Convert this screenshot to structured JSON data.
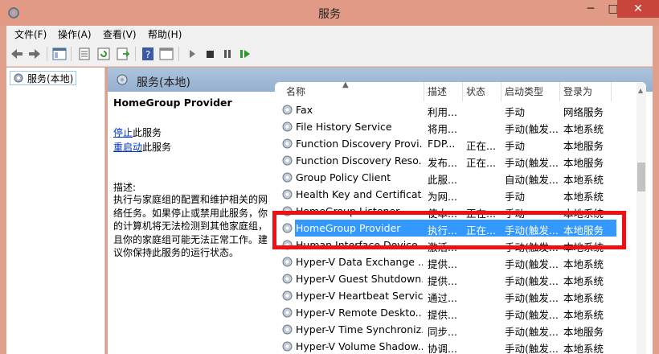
{
  "window": {
    "title": "服务"
  },
  "menu": [
    "文件(F)",
    "操作(A)",
    "查看(V)",
    "帮助(H)"
  ],
  "tree": {
    "item": "服务(本地)"
  },
  "main": {
    "header": "服务(本地)"
  },
  "detail": {
    "service_name": "HomeGroup Provider",
    "action_stop_link": "停止",
    "action_stop_suffix": "此服务",
    "action_restart_link": "重启动",
    "action_restart_suffix": "此服务",
    "desc_label": "描述:",
    "desc_text": "执行与家庭组的配置和维护相关的网络任务。如果停止或禁用此服务，你的计算机将无法检测到其他家庭组，且你的家庭组可能无法正常工作。建议你保持此服务的运行状态。"
  },
  "columns": [
    "名称",
    "描述",
    "状态",
    "启动类型",
    "登录为"
  ],
  "services": [
    [
      "Fax",
      "利用...",
      "",
      "手动",
      "网络服务"
    ],
    [
      "File History Service",
      "将用...",
      "",
      "手动(触发...",
      "本地系统"
    ],
    [
      "Function Discovery Provi...",
      "FDP...",
      "正在...",
      "手动",
      "本地服务"
    ],
    [
      "Function Discovery Reso...",
      "发布...",
      "正在...",
      "手动(触发...",
      "本地服务"
    ],
    [
      "Group Policy Client",
      "此服...",
      "",
      "自动(触发...",
      "本地系统"
    ],
    [
      "Health Key and Certificat...",
      "为网...",
      "",
      "手动",
      "本地系统"
    ],
    [
      "HomeGroup Listener",
      "使本...",
      "正在...",
      "手动",
      "本地系统"
    ],
    [
      "HomeGroup Provider",
      "执行...",
      "正在...",
      "手动(触发...",
      "本地服务"
    ],
    [
      "Human Interface Device ...",
      "激活...",
      "",
      "手动(触发...",
      "本地系统"
    ],
    [
      "Hyper-V Data Exchange ...",
      "提供...",
      "",
      "手动(触发...",
      "本地系统"
    ],
    [
      "Hyper-V Guest Shutdown...",
      "提供...",
      "",
      "手动(触发...",
      "本地系统"
    ],
    [
      "Hyper-V Heartbeat Service",
      "通过...",
      "",
      "手动(触发...",
      "本地系统"
    ],
    [
      "Hyper-V Remote Deskto...",
      "提供...",
      "",
      "手动(触发...",
      "本地系统"
    ],
    [
      "Hyper-V Time Synchroniz...",
      "同步...",
      "",
      "手动(触发...",
      "本地服务"
    ],
    [
      "Hyper-V Volume Shadow...",
      "协调...",
      "",
      "手动(触发...",
      "本地系统"
    ]
  ],
  "selected_index": 7,
  "colors": {
    "selection": "#3399ff",
    "highlight_box": "#ee1111",
    "title_bar": "#e09a86",
    "link": "#0033cc"
  }
}
